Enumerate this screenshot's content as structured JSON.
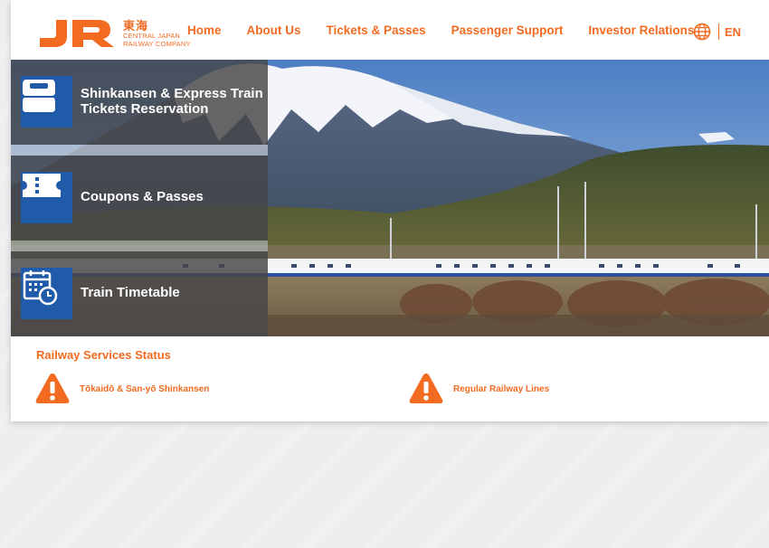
{
  "brand": {
    "logo_text": "JR",
    "kanji": "東海",
    "company_line1": "CENTRAL JAPAN",
    "company_line2": "RAILWAY COMPANY",
    "color": "#f26b21"
  },
  "nav": {
    "items": [
      {
        "label": "Home"
      },
      {
        "label": "About Us"
      },
      {
        "label": "Tickets & Passes"
      },
      {
        "label": "Passenger Support"
      },
      {
        "label": "Investor Relations"
      }
    ],
    "language": "EN",
    "language_icon": "globe-icon"
  },
  "hero": {
    "panels": [
      {
        "line1": "Shinkansen & Express Train",
        "line2": "Tickets Reservation",
        "icon": "train-seat-icon"
      },
      {
        "line1": "Coupons & Passes",
        "icon": "ticket-icon"
      },
      {
        "line1": "Train Timetable",
        "icon": "calendar-clock-icon"
      }
    ],
    "panel_color": "#1f5ba8"
  },
  "status": {
    "title": "Railway Services Status",
    "items": [
      {
        "label": "Tōkaidō & San-yō Shinkansen",
        "icon": "warning-icon"
      },
      {
        "label": "Regular Railway Lines",
        "icon": "warning-icon"
      }
    ]
  }
}
